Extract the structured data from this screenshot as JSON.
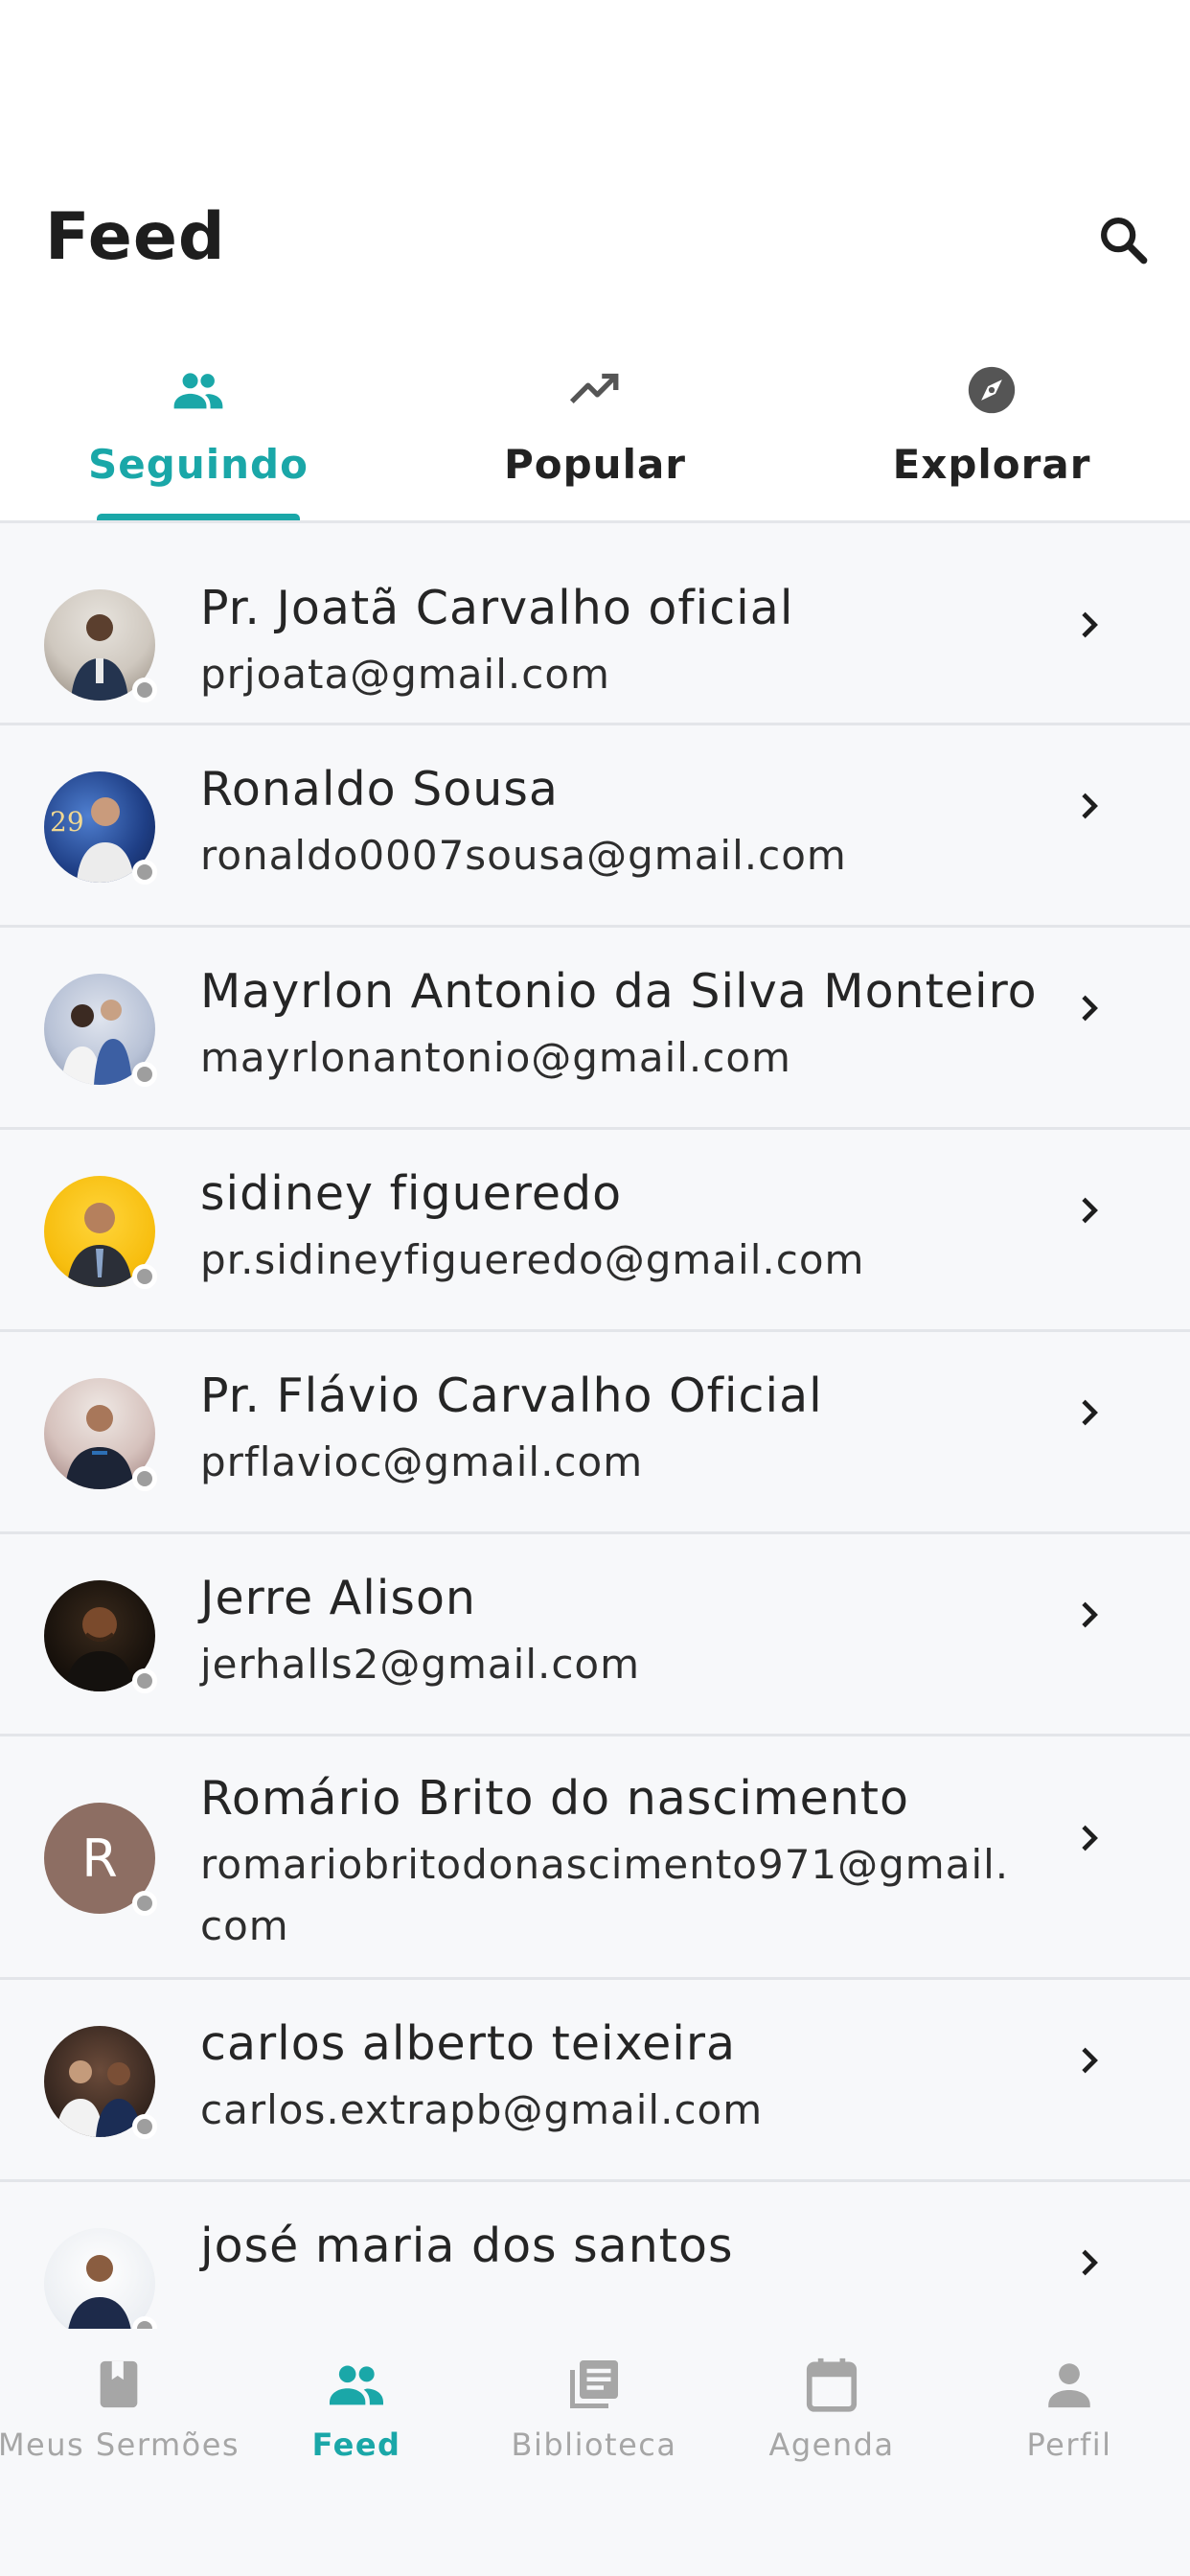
{
  "header": {
    "title": "Feed"
  },
  "tabs": [
    {
      "label": "Seguindo",
      "icon": "people-icon",
      "active": true
    },
    {
      "label": "Popular",
      "icon": "trending-up-icon",
      "active": false
    },
    {
      "label": "Explorar",
      "icon": "compass-icon",
      "active": false
    }
  ],
  "colors": {
    "accent": "#1aa7a8",
    "inactive": "#a6a6a6",
    "status_offline": "#9e9e9e",
    "list_bg": "#f7f8fa"
  },
  "following": [
    {
      "name": "Pr. Joatã Carvalho oficial",
      "email": "prjoata@gmail.com"
    },
    {
      "name": "Ronaldo Sousa",
      "email": "ronaldo0007sousa@gmail.com"
    },
    {
      "name": "Mayrlon Antonio da Silva Monteiro",
      "email": "mayrlonantonio@gmail.com"
    },
    {
      "name": "sidiney figueredo",
      "email": "pr.sidineyfigueredo@gmail.com"
    },
    {
      "name": "Pr. Flávio Carvalho Oficial",
      "email": "prflavioc@gmail.com"
    },
    {
      "name": "Jerre Alison",
      "email": "jerhalls2@gmail.com"
    },
    {
      "name": "Romário Brito do nascimento",
      "email": "romariobritodonascimento971@gmail.com",
      "initial": "R"
    },
    {
      "name": "carlos alberto teixeira",
      "email": "carlos.extrapb@gmail.com"
    },
    {
      "name": "josé maria dos santos",
      "email": ""
    }
  ],
  "bottom_nav": [
    {
      "label": "Meus Sermões",
      "icon": "book-icon",
      "active": false
    },
    {
      "label": "Feed",
      "icon": "people-icon",
      "active": true
    },
    {
      "label": "Biblioteca",
      "icon": "library-icon",
      "active": false
    },
    {
      "label": "Agenda",
      "icon": "calendar-icon",
      "active": false
    },
    {
      "label": "Perfil",
      "icon": "person-icon",
      "active": false
    }
  ]
}
